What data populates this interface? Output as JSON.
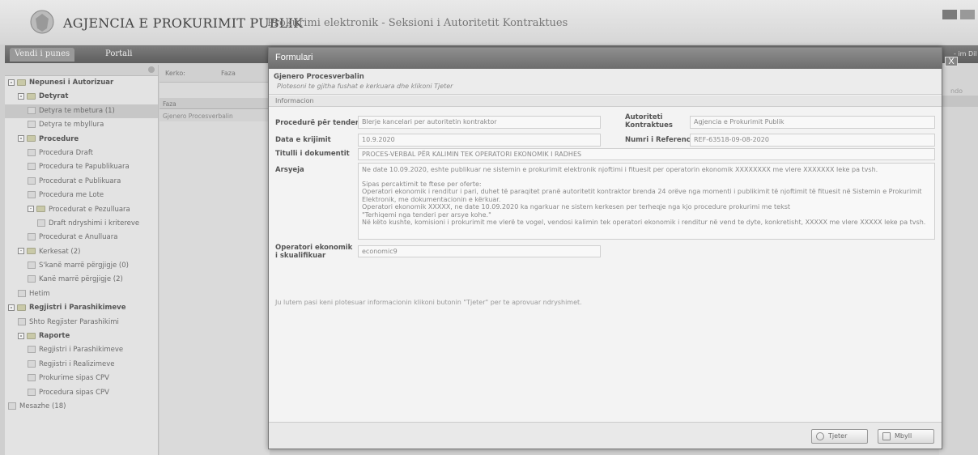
{
  "header": {
    "agency": "AGJENCIA E PROKURIMIT PUBLIK",
    "subtitle": "Prokurimi elektronik - Seksioni i Autoritetit Kontraktues"
  },
  "nav": {
    "tabs": [
      "Vendi i punes",
      "Portali"
    ],
    "right_text": "- im Dil"
  },
  "sidebar": {
    "items": [
      {
        "label": "Nepunesi i Autorizuar",
        "level": 0,
        "bold": true,
        "expander": "-",
        "icon": "folder-icon"
      },
      {
        "label": "Detyrat",
        "level": 1,
        "bold": true,
        "expander": "-",
        "icon": "folder-icon"
      },
      {
        "label": "Detyra te mbetura (1)",
        "level": 2,
        "selected": true,
        "icon": "page-icon"
      },
      {
        "label": "Detyra te mbyllura",
        "level": 2,
        "icon": "page-icon"
      },
      {
        "label": "Procedure",
        "level": 1,
        "bold": true,
        "expander": "-",
        "icon": "folder-icon"
      },
      {
        "label": "Procedura Draft",
        "level": 2,
        "icon": "page-icon"
      },
      {
        "label": "Procedura te Papublikuara",
        "level": 2,
        "icon": "page-icon"
      },
      {
        "label": "Procedurat e Publikuara",
        "level": 2,
        "icon": "page-icon"
      },
      {
        "label": "Procedura me Lote",
        "level": 2,
        "icon": "page-icon"
      },
      {
        "label": "Procedurat e Pezulluara",
        "level": 2,
        "expander": "-",
        "icon": "folder-icon"
      },
      {
        "label": "Draft ndryshimi i kritereve",
        "level": 3,
        "icon": "page-icon"
      },
      {
        "label": "Procedurat e Anulluara",
        "level": 2,
        "icon": "page-icon"
      },
      {
        "label": "Kerkesat (2)",
        "level": 1,
        "expander": "-",
        "icon": "folder-icon"
      },
      {
        "label": "S'kanë marrë përgjigje (0)",
        "level": 2,
        "icon": "page-icon"
      },
      {
        "label": "Kanë marrë përgjigje (2)",
        "level": 2,
        "icon": "page-icon"
      },
      {
        "label": "Hetim",
        "level": 1,
        "icon": "page-icon"
      },
      {
        "label": "Regjistri i Parashikimeve",
        "level": 0,
        "bold": true,
        "expander": "-",
        "icon": "folder-icon"
      },
      {
        "label": "Shto Regjister Parashikimi",
        "level": 1,
        "icon": "page-icon"
      },
      {
        "label": "Raporte",
        "level": 1,
        "bold": true,
        "expander": "-",
        "icon": "folder-icon"
      },
      {
        "label": "Regjistri i Parashikimeve",
        "level": 2,
        "icon": "page-icon"
      },
      {
        "label": "Regjistri i Realizimeve",
        "level": 2,
        "icon": "page-icon"
      },
      {
        "label": "Prokurime sipas CPV",
        "level": 2,
        "icon": "page-icon"
      },
      {
        "label": "Procedura sipas CPV",
        "level": 2,
        "icon": "page-icon"
      },
      {
        "label": "Mesazhe (18)",
        "level": 0,
        "icon": "page-icon"
      }
    ]
  },
  "middle": {
    "search_label": "Kerko:",
    "filter_label": "Faza",
    "column_header": "Faza",
    "row_value": "Gjenero Procesverbalin"
  },
  "background_right": {
    "text": "ndo"
  },
  "modal": {
    "title": "Formulari",
    "window_buttons": [
      "_",
      "□",
      "X"
    ],
    "form_title": "Gjenero Procesverbalin",
    "form_instruction": "Plotesoni te gjitha fushat e kerkuara dhe klikoni Tjeter",
    "section": "Informacion",
    "fields": {
      "procedure_label": "Procedurë për tender",
      "procedure_value": "Blerje kancelari per autoritetin kontraktor",
      "authority_label": "Autoriteti Kontraktues",
      "authority_value": "Agjencia e Prokurimit Publik",
      "date_label": "Data e krijimit",
      "date_value": "10.9.2020",
      "ref_label": "Numri i References",
      "ref_value": "REF-63518-09-08-2020",
      "doc_title_label": "Titulli i dokumentit",
      "doc_title_value": "PROCES-VERBAL PËR KALIMIN TEK OPERATORI EKONOMIK I RADHES",
      "reason_label": "Arsyeja",
      "reason_lines": [
        "Ne date 10.09.2020, eshte publikuar ne sistemin e prokurimit elektronik njoftimi i fituesit per operatorin ekonomik XXXXXXXX me vlere XXXXXXX leke pa tvsh.",
        "Sipas percaktimit te ftese per oferte:",
        "Operatori ekonomik i renditur i pari, duhet të paraqitet pranë autoritetit kontraktor brenda 24 orëve nga momenti i publikimit të njoftimit të fituesit në Sistemin e Prokurimit Elektronik, me dokumentacionin e kërkuar.",
        "Operatori ekonomik XXXXX, ne date 10.09.2020 ka ngarkuar ne sistem kerkesen per terheqje nga kjo procedure prokurimi me tekst",
        "\"Terhiqemi nga tenderi per arsye kohe.\"",
        "Në këto kushte, komisioni i prokurimit me vlerë te vogel, vendosi kalimin tek operatori ekonomik i renditur në vend te dyte, konkretisht, XXXXX me vlere XXXXX leke pa tvsh."
      ],
      "operator_label": "Operatori ekonomik i skualifikuar",
      "operator_value": "economic9"
    },
    "note": "Ju lutem pasi keni plotesuar informacionin klikoni butonin \"Tjeter\" per te aprovuar ndryshimet.",
    "buttons": {
      "next": "Tjeter",
      "close": "Mbyll"
    }
  }
}
